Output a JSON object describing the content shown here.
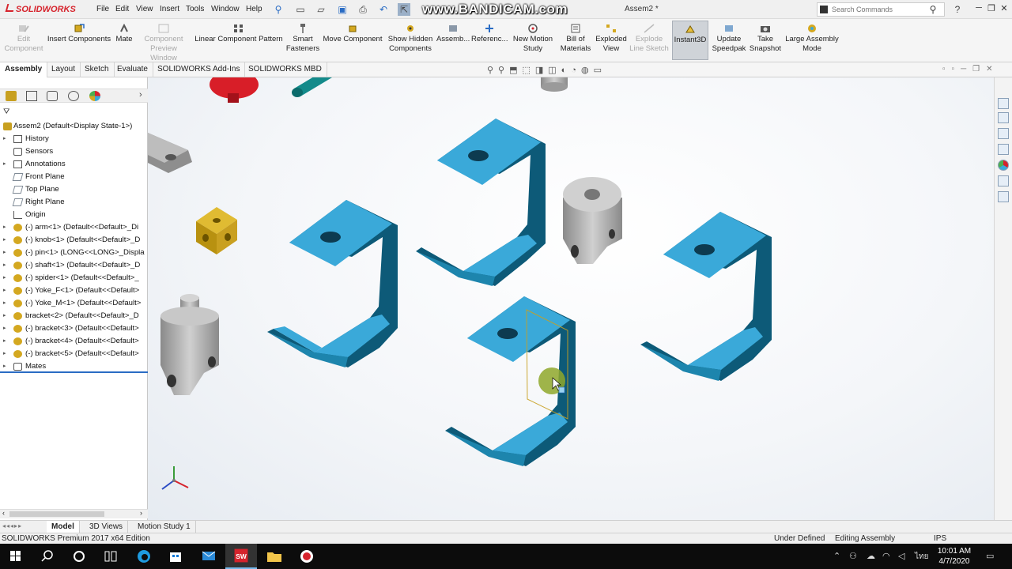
{
  "app": {
    "logo_text": "SOLIDWORKS",
    "doc_title": "Assem2 *",
    "watermark": "www.BANDICAM.com"
  },
  "menu": [
    "File",
    "Edit",
    "View",
    "Insert",
    "Tools",
    "Window",
    "Help"
  ],
  "search": {
    "placeholder": "Search Commands"
  },
  "commands": [
    {
      "label": "Edit Component",
      "state": "disabled"
    },
    {
      "label": "Insert Components",
      "state": "normal"
    },
    {
      "label": "Mate",
      "state": "normal"
    },
    {
      "label": "Component Preview Window",
      "state": "disabled"
    },
    {
      "label": "Linear Component Pattern",
      "state": "normal"
    },
    {
      "label": "Smart Fasteners",
      "state": "normal"
    },
    {
      "label": "Move Component",
      "state": "normal"
    },
    {
      "label": "Show Hidden Components",
      "state": "normal"
    },
    {
      "label": "Assemb...",
      "state": "normal"
    },
    {
      "label": "Referenc...",
      "state": "normal"
    },
    {
      "label": "New Motion Study",
      "state": "normal"
    },
    {
      "label": "Bill of Materials",
      "state": "normal"
    },
    {
      "label": "Exploded View",
      "state": "normal"
    },
    {
      "label": "Explode Line Sketch",
      "state": "disabled"
    },
    {
      "label": "Instant3D",
      "state": "active"
    },
    {
      "label": "Update Speedpak",
      "state": "normal"
    },
    {
      "label": "Take Snapshot",
      "state": "normal"
    },
    {
      "label": "Large Assembly Mode",
      "state": "normal"
    }
  ],
  "tabs": [
    "Assembly",
    "Layout",
    "Sketch",
    "Evaluate",
    "SOLIDWORKS Add-Ins",
    "SOLIDWORKS MBD"
  ],
  "active_tab": "Assembly",
  "tree": [
    {
      "label": "Assem2  (Default<Display State-1>)",
      "icon": "assembly-icon",
      "arrow": false
    },
    {
      "label": "History",
      "icon": "history-icon",
      "arrow": true
    },
    {
      "label": "Sensors",
      "icon": "sensor-icon",
      "arrow": false
    },
    {
      "label": "Annotations",
      "icon": "annotation-icon",
      "arrow": true
    },
    {
      "label": "Front Plane",
      "icon": "plane-icon",
      "arrow": false
    },
    {
      "label": "Top Plane",
      "icon": "plane-icon",
      "arrow": false
    },
    {
      "label": "Right Plane",
      "icon": "plane-icon",
      "arrow": false
    },
    {
      "label": "Origin",
      "icon": "origin-icon",
      "arrow": false
    },
    {
      "label": "(-) arm<1> (Default<<Default>_Di",
      "icon": "part-icon",
      "arrow": true
    },
    {
      "label": "(-) knob<1> (Default<<Default>_D",
      "icon": "part-icon",
      "arrow": true
    },
    {
      "label": "(-) pin<1> (LONG<<LONG>_Displa",
      "icon": "part-icon",
      "arrow": true
    },
    {
      "label": "(-) shaft<1> (Default<<Default>_D",
      "icon": "part-icon",
      "arrow": true
    },
    {
      "label": "(-) spider<1> (Default<<Default>_",
      "icon": "part-icon",
      "arrow": true
    },
    {
      "label": "(-) Yoke_F<1> (Default<<Default>",
      "icon": "part-icon",
      "arrow": true
    },
    {
      "label": "(-) Yoke_M<1> (Default<<Default>",
      "icon": "part-icon",
      "arrow": true
    },
    {
      "label": "bracket<2> (Default<<Default>_D",
      "icon": "part-icon",
      "arrow": true
    },
    {
      "label": "(-) bracket<3> (Default<<Default>",
      "icon": "part-icon",
      "arrow": true
    },
    {
      "label": "(-) bracket<4> (Default<<Default>",
      "icon": "part-icon",
      "arrow": true
    },
    {
      "label": "(-) bracket<5> (Default<<Default>",
      "icon": "part-icon",
      "arrow": true
    },
    {
      "label": "Mates",
      "icon": "mates-icon",
      "arrow": true
    }
  ],
  "bottom_tabs": [
    "Model",
    "3D Views",
    "Motion Study 1"
  ],
  "active_bottom_tab": "Model",
  "status": {
    "edition": "SOLIDWORKS Premium 2017 x64 Edition",
    "definition": "Under Defined",
    "mode": "Editing Assembly",
    "units": "IPS"
  },
  "taskbar": {
    "time": "10:01 AM",
    "date": "4/7/2020",
    "lang": "ไทย"
  },
  "colors": {
    "bracket": "#3aa9d9",
    "bracket_dark": "#0d5a78",
    "gray_part": "#a3a3a3",
    "spider": "#d4a820",
    "knob": "#d81e28",
    "accent_red": "#d6232c"
  }
}
